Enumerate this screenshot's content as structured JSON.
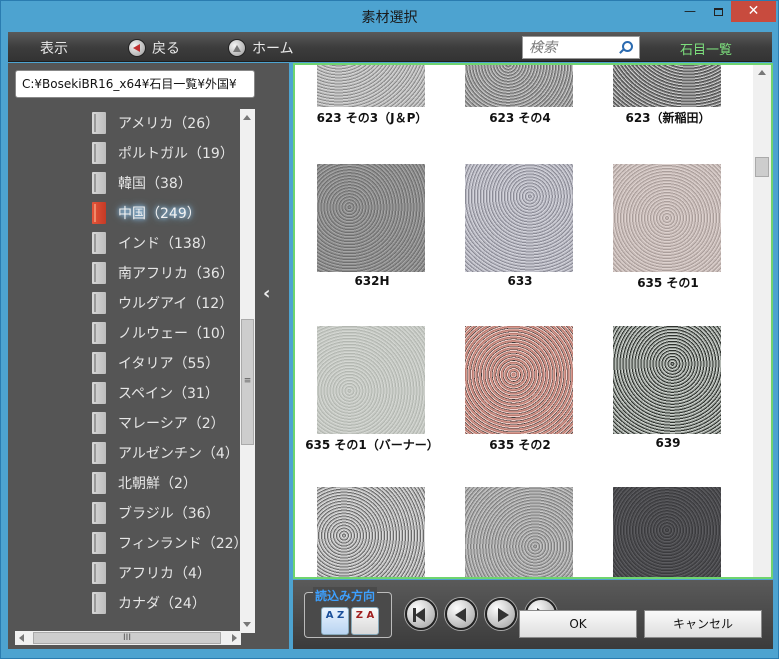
{
  "window": {
    "title": "素材選択",
    "minimize": "—",
    "close": "✕"
  },
  "toolbar": {
    "view_label": "表示",
    "back_label": "戻る",
    "home_label": "ホーム",
    "search_placeholder": "検索",
    "stone_list_label": "石目一覧"
  },
  "left": {
    "path": "C:¥BosekiBR16_x64¥石目一覧¥外国¥",
    "tree": [
      {
        "label": "アメリカ（26）",
        "selected": false
      },
      {
        "label": "ポルトガル（19）",
        "selected": false
      },
      {
        "label": "韓国（38）",
        "selected": false
      },
      {
        "label": "中国（249）",
        "selected": true
      },
      {
        "label": "インド（138）",
        "selected": false
      },
      {
        "label": "南アフリカ（36）",
        "selected": false
      },
      {
        "label": "ウルグアイ（12）",
        "selected": false
      },
      {
        "label": "ノルウェー（10）",
        "selected": false
      },
      {
        "label": "イタリア（55）",
        "selected": false
      },
      {
        "label": "スペイン（31）",
        "selected": false
      },
      {
        "label": "マレーシア（2）",
        "selected": false
      },
      {
        "label": "アルゼンチン（4）",
        "selected": false
      },
      {
        "label": "北朝鮮（2）",
        "selected": false
      },
      {
        "label": "ブラジル（36）",
        "selected": false
      },
      {
        "label": "フィンランド（22）",
        "selected": false
      },
      {
        "label": "アフリカ（4）",
        "selected": false
      },
      {
        "label": "カナダ（24）",
        "selected": false
      }
    ],
    "scroll_grip": "≡",
    "hscroll_grip": "III",
    "collapse_glyph": "‹"
  },
  "grid": {
    "rows": [
      [
        "623 その3（J＆P）",
        "623 その4",
        "623（新稲田）"
      ],
      [
        "632H",
        "633",
        "635 その1"
      ],
      [
        "635 その1（バーナー）",
        "635 その2",
        "639"
      ],
      [
        "",
        "",
        ""
      ]
    ]
  },
  "bottom": {
    "direction_label": "読込み方向",
    "sort_az": "A Z",
    "sort_za": "Z A",
    "ok_label": "OK",
    "cancel_label": "キャンセル"
  }
}
